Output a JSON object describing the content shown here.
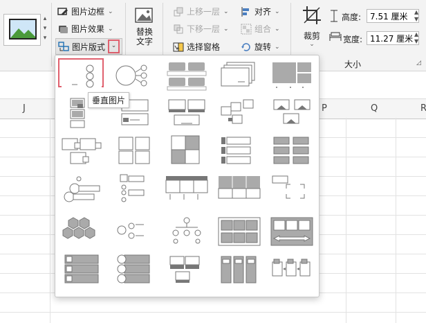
{
  "ribbon": {
    "picture_border": "图片边框",
    "picture_effects": "图片效果",
    "picture_layout": "图片版式",
    "alt_text_line1": "替换",
    "alt_text_line2": "文字",
    "bring_forward": "上移一层",
    "send_backward": "下移一层",
    "selection_pane": "选择窗格",
    "align": "对齐",
    "group": "组合",
    "rotate": "旋转",
    "crop": "裁剪",
    "height_label": "高度:",
    "height_value": "7.51 厘米",
    "width_label": "宽度:",
    "width_value": "11.27 厘米",
    "size_group_label": "大小"
  },
  "columns": [
    "J",
    "P",
    "Q",
    "R"
  ],
  "tooltip": "垂直图片",
  "icons": {
    "picture_border": "picture-border-icon",
    "picture_effects": "picture-effects-icon",
    "picture_layout": "picture-layout-icon",
    "alt_text": "alt-text-icon",
    "crop": "crop-icon",
    "height": "height-icon",
    "width": "width-icon"
  },
  "accent": "#e0606e"
}
